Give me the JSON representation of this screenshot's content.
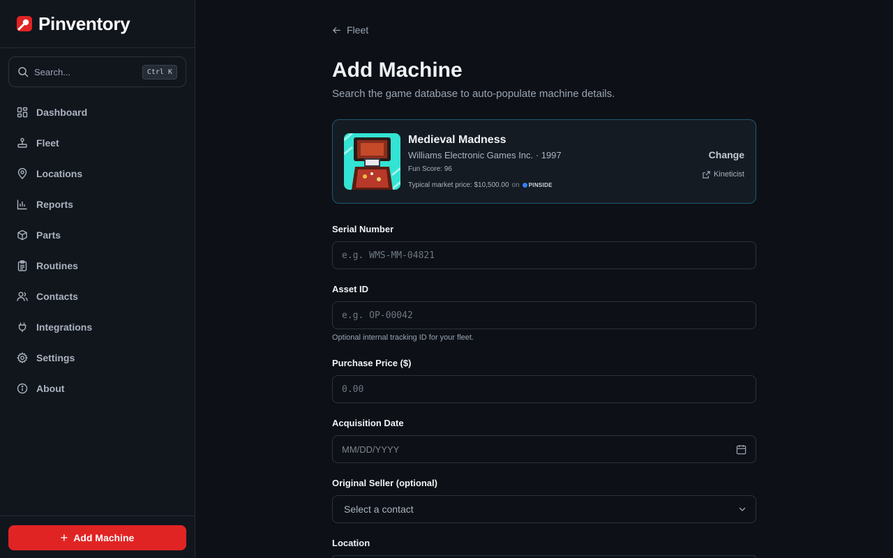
{
  "brand": {
    "name": "Pinventory",
    "accent": "#e02424"
  },
  "search": {
    "placeholder": "Search...",
    "shortcut": "Ctrl K"
  },
  "nav": [
    {
      "label": "Dashboard",
      "icon": "dashboard-icon"
    },
    {
      "label": "Fleet",
      "icon": "joystick-icon"
    },
    {
      "label": "Locations",
      "icon": "map-pin-icon"
    },
    {
      "label": "Reports",
      "icon": "bar-chart-icon"
    },
    {
      "label": "Parts",
      "icon": "box-icon"
    },
    {
      "label": "Routines",
      "icon": "clipboard-icon"
    },
    {
      "label": "Contacts",
      "icon": "users-icon"
    },
    {
      "label": "Integrations",
      "icon": "plug-icon"
    },
    {
      "label": "Settings",
      "icon": "gear-icon"
    },
    {
      "label": "About",
      "icon": "info-icon"
    }
  ],
  "footer": {
    "add_label": "Add Machine"
  },
  "page": {
    "back_label": "Fleet",
    "title": "Add Machine",
    "subtitle": "Search the game database to auto-populate machine details."
  },
  "game": {
    "name": "Medieval Madness",
    "manufacturer_year": "Williams Electronic Games Inc. · 1997",
    "fun_score": "Fun Score: 96",
    "market_price": "Typical market price: $10,500.00",
    "market_on": "on",
    "market_source": "PINSIDE",
    "change_label": "Change",
    "external_label": "Kineticist"
  },
  "form": {
    "serial": {
      "label": "Serial Number",
      "placeholder": "e.g. WMS-MM-04821"
    },
    "asset": {
      "label": "Asset ID",
      "placeholder": "e.g. OP-00042",
      "help": "Optional internal tracking ID for your fleet."
    },
    "price": {
      "label": "Purchase Price ($)",
      "placeholder": "0.00"
    },
    "date": {
      "label": "Acquisition Date",
      "placeholder": "MM/DD/YYYY"
    },
    "seller": {
      "label": "Original Seller (optional)",
      "placeholder": "Select a contact"
    },
    "location": {
      "label": "Location"
    }
  }
}
